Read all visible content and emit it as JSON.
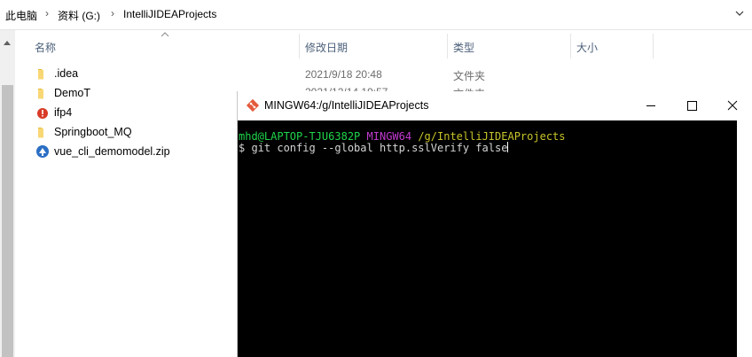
{
  "address_bar": {
    "crumbs": [
      "此电脑",
      "资料 (G:)",
      "IntelliJIDEAProjects"
    ]
  },
  "columns": {
    "name": "名称",
    "modified": "修改日期",
    "type": "类型",
    "size": "大小"
  },
  "files": [
    {
      "name": ".idea",
      "modified": "2021/9/18 20:48",
      "type": "文件夹",
      "icon": "folder-icon"
    },
    {
      "name": "DemoT",
      "modified": "2021/12/14 19:57",
      "type": "文件夹",
      "icon": "folder-icon"
    },
    {
      "name": "ifp4",
      "modified": "",
      "type": "",
      "icon": "project-icon"
    },
    {
      "name": "Springboot_MQ",
      "modified": "",
      "type": "",
      "icon": "folder-icon"
    },
    {
      "name": "vue_cli_demomodel.zip",
      "modified": "",
      "type": "",
      "icon": "zip-file-icon"
    }
  ],
  "terminal": {
    "title": "MINGW64:/g/IntelliJIDEAProjects",
    "prompt_user": "mhd@LAPTOP-TJU6382P",
    "prompt_env": "MINGW64",
    "prompt_path": "/g/IntelliJIDEAProjects",
    "command": "$ git config --global http.sslVerify false",
    "colors": {
      "user": "#1fd44b",
      "env": "#c33ad0",
      "path": "#c8c42a",
      "text": "#d4d4d4"
    }
  }
}
